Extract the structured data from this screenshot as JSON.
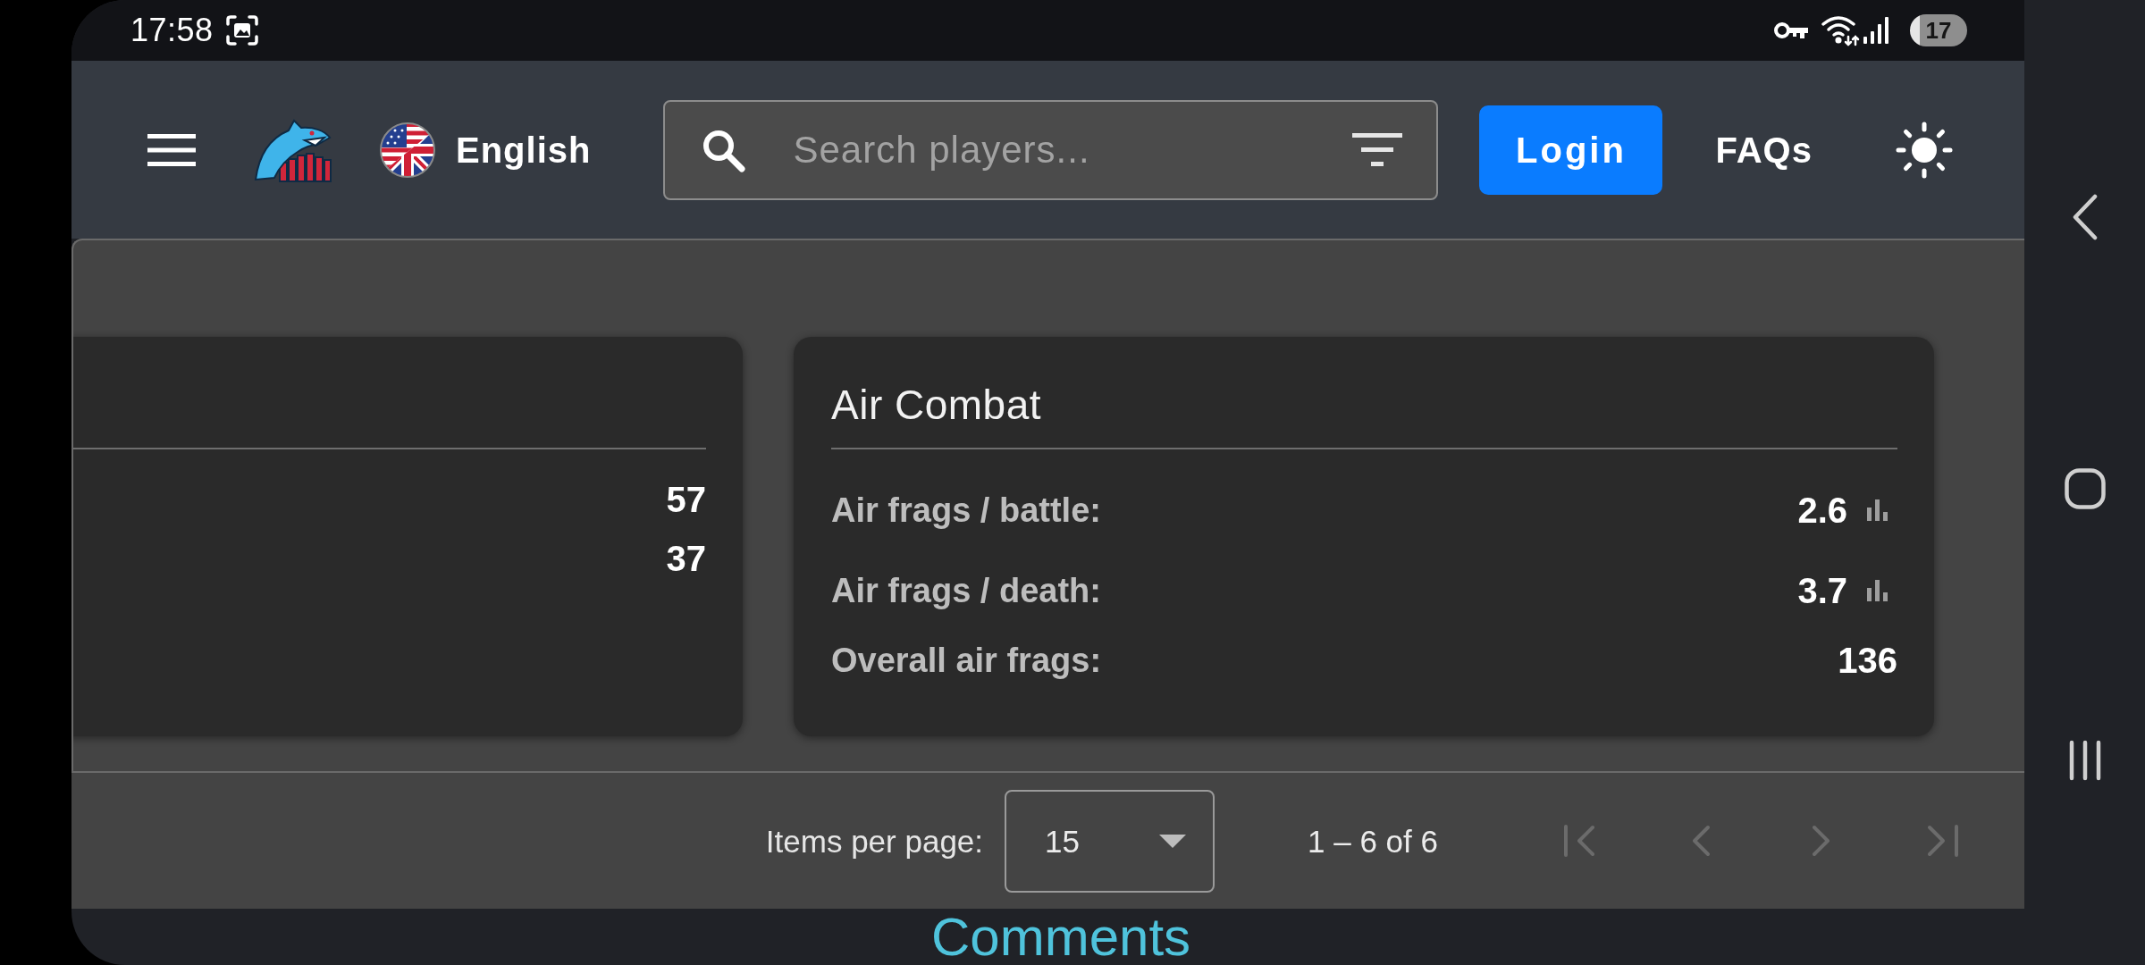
{
  "status_bar": {
    "time": "17:58",
    "battery": "17"
  },
  "header": {
    "language": "English",
    "search": {
      "placeholder": "Search players..."
    },
    "login": "Login",
    "faqs": "FAQs"
  },
  "cards": [
    {
      "rows": [
        {
          "kind": "plain",
          "value": "57"
        },
        {
          "kind": "plain",
          "value": "37"
        }
      ]
    },
    {
      "title": "Air Combat",
      "rows": [
        {
          "kind": "charted",
          "label": "Air frags / battle:",
          "value": "2.6"
        },
        {
          "kind": "charted",
          "label": "Air frags / death:",
          "value": "3.7"
        },
        {
          "kind": "plain",
          "label": "Overall air frags:",
          "value": "136"
        }
      ]
    }
  ],
  "pagination": {
    "label": "Items per page:",
    "page_size": "15",
    "range": "1 – 6 of 6",
    "buttons": [
      {
        "kind": "first",
        "disabled": true
      },
      {
        "kind": "previous",
        "disabled": true
      },
      {
        "kind": "next",
        "disabled": true
      },
      {
        "kind": "last",
        "disabled": true
      }
    ]
  },
  "comments": {
    "title": "Comments"
  }
}
